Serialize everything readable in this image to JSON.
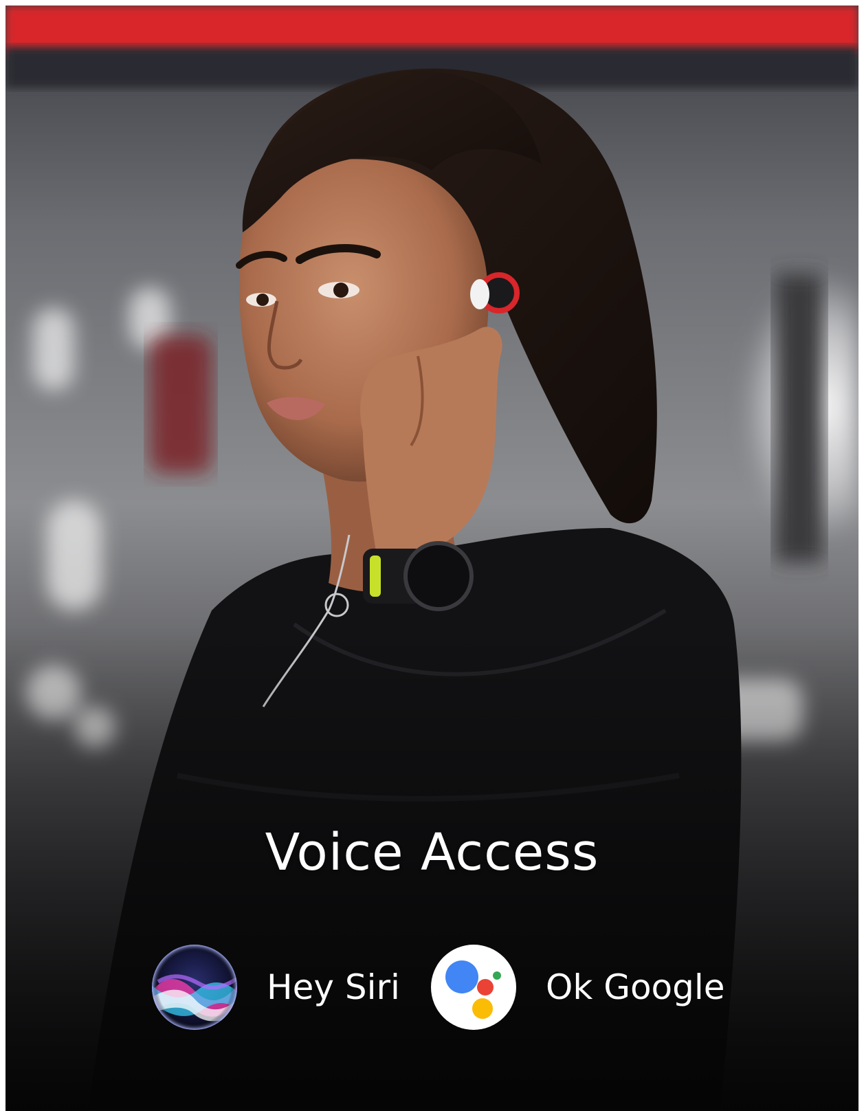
{
  "title": "Voice Access",
  "assistants": [
    {
      "label": "Hey Siri",
      "icon": "siri-logo-icon"
    },
    {
      "label": "Ok Google",
      "icon": "google-assistant-logo-icon"
    }
  ],
  "colors": {
    "google_blue": "#4285F4",
    "google_red": "#EA4335",
    "google_yellow": "#FBBC05",
    "google_green": "#34A853",
    "header_red": "#d8262b"
  }
}
